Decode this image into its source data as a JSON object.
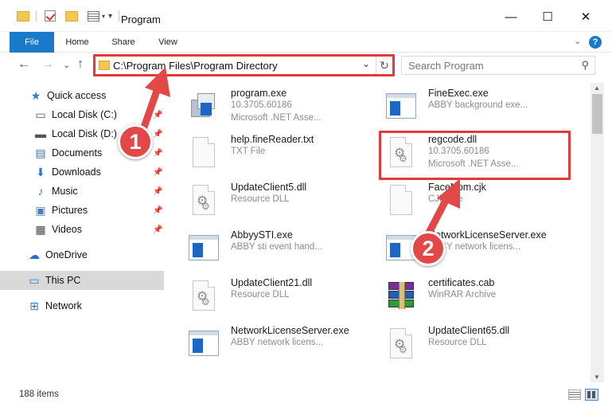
{
  "window": {
    "title": "Program",
    "minimize_glyph": "—",
    "maximize_glyph": "☐",
    "close_glyph": "✕"
  },
  "ribbon": {
    "tabs": [
      "File",
      "Home",
      "Share",
      "View"
    ],
    "expand_glyph": "⌄",
    "help_glyph": "?"
  },
  "nav": {
    "back_glyph": "←",
    "forward_glyph": "→",
    "recent_glyph": "⌄",
    "up_glyph": "↑",
    "address": "C:\\Program Files\\Program Directory",
    "dropdown_glyph": "⌄",
    "refresh_glyph": "↻",
    "search_placeholder": "Search Program",
    "search_glyph": "⚲"
  },
  "sidebar": {
    "items": [
      {
        "label": "Quick access",
        "icon": "star-icon",
        "glyph": "★",
        "color": "#2b7cd3",
        "pinned": false
      },
      {
        "label": "Local Disk (C:)",
        "icon": "drive-icon",
        "glyph": "▭",
        "color": "#555555",
        "pinned": true
      },
      {
        "label": "Local Disk (D:)",
        "icon": "drive-icon",
        "glyph": "▬",
        "color": "#555555",
        "pinned": true
      },
      {
        "label": "Documents",
        "icon": "documents-icon",
        "glyph": "▤",
        "color": "#4a6f9a",
        "pinned": true
      },
      {
        "label": "Downloads",
        "icon": "download-icon",
        "glyph": "⬇",
        "color": "#2b7cd3",
        "pinned": true
      },
      {
        "label": "Music",
        "icon": "music-icon",
        "glyph": "♪",
        "color": "#2b7cd3",
        "pinned": true
      },
      {
        "label": "Pictures",
        "icon": "pictures-icon",
        "glyph": "▣",
        "color": "#4a7db0",
        "pinned": true
      },
      {
        "label": "Videos",
        "icon": "video-icon",
        "glyph": "▦",
        "color": "#444444",
        "pinned": true
      },
      {
        "label": "OneDrive",
        "icon": "cloud-icon",
        "glyph": "☁",
        "color": "#1f6fd1",
        "pinned": false
      },
      {
        "label": "This PC",
        "icon": "computer-icon",
        "glyph": "▭",
        "color": "#2b7cd3",
        "pinned": false
      },
      {
        "label": "Network",
        "icon": "network-icon",
        "glyph": "⊞",
        "color": "#2b7cd3",
        "pinned": false
      }
    ],
    "pin_glyph": "📌"
  },
  "files": [
    {
      "name": "program.exe",
      "l1": "10.3705.60186",
      "l2": "Microsoft .NET Asse...",
      "icon": "program"
    },
    {
      "name": "FineExec.exe",
      "l1": "ABBY background exe...",
      "l2": "",
      "icon": "app"
    },
    {
      "name": "help.fineReader.txt",
      "l1": "TXT File",
      "l2": "",
      "icon": "doc"
    },
    {
      "name": "regcode.dll",
      "l1": "10.3705.60186",
      "l2": "Microsoft .NET Asse...",
      "icon": "dll"
    },
    {
      "name": "UpdateClient5.dll",
      "l1": "Resource DLL",
      "l2": "",
      "icon": "dll"
    },
    {
      "name": "FaceNom.cjk",
      "l1": "CJK File",
      "l2": "",
      "icon": "doc"
    },
    {
      "name": "AbbyySTI.exe",
      "l1": "ABBY sti event hand...",
      "l2": "",
      "icon": "app"
    },
    {
      "name": "NetworkLicenseServer.exe",
      "l1": "ABBY network licens...",
      "l2": "",
      "icon": "app"
    },
    {
      "name": "UpdateClient21.dll",
      "l1": "Resource DLL",
      "l2": "",
      "icon": "dll"
    },
    {
      "name": "certificates.cab",
      "l1": "WinRAR Archive",
      "l2": "",
      "icon": "rar"
    },
    {
      "name": "NetworkLicenseServer.exe",
      "l1": "ABBY network licens...",
      "l2": "",
      "icon": "app"
    },
    {
      "name": "UpdateClient65.dll",
      "l1": "Resource DLL",
      "l2": "",
      "icon": "dll"
    }
  ],
  "scroll": {
    "up_glyph": "▲",
    "down_glyph": "▼"
  },
  "status": {
    "count": "188 items"
  },
  "annotations": {
    "step1": "1",
    "step2": "2"
  },
  "colors": {
    "accent": "#1979ca",
    "highlight": "#e23a3a",
    "badge": "#e24848",
    "selected": "#d9d9d9"
  }
}
